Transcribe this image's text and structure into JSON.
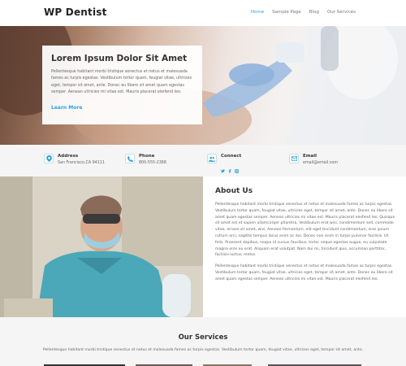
{
  "site": {
    "logo": "WP Dentist"
  },
  "nav": {
    "items": [
      {
        "label": "Home",
        "active": true
      },
      {
        "label": "Sample Page",
        "active": false
      },
      {
        "label": "Blog",
        "active": false
      },
      {
        "label": "Our Services",
        "active": false
      }
    ]
  },
  "hero": {
    "title": "Lorem Ipsum Dolor Sit Amet",
    "text": "Pellentesque habitant morbi tristique senectus et netus et malesuada fames ac turpis egestas. Vestibulum tortor quam, feugiat vitae, ultricies eget, tempor sit amet, ante. Donec eu libero sit amet quam egestas semper. Aenean ultricies mi vitae est. Mauris placerat eleifend leo.",
    "link": "Learn More"
  },
  "info": {
    "address": {
      "label": "Address",
      "value": "San Francisco,CA 94111",
      "icon": "location-pin-icon"
    },
    "phone": {
      "label": "Phone",
      "value": "800-555-2368",
      "icon": "phone-icon"
    },
    "connect": {
      "label": "Connect",
      "icon": "users-icon",
      "social": [
        "twitter-icon",
        "facebook-icon",
        "instagram-icon"
      ]
    },
    "email": {
      "label": "Email",
      "value": "email@email.com",
      "icon": "envelope-icon"
    }
  },
  "about": {
    "title": "About Us",
    "paragraph1": "Pellentesque habitant morbi tristique senectus et netus et malesuada fames ac turpis egestas. Vestibulum tortor quam, feugiat vitae, ultricies eget, tempor sit amet, ante. Donec eu libero sit amet quam egestas semper. Aenean ultricies mi vitae est. Mauris placerat eleifend leo. Quisque sit amet est et sapien ullamcorper pharetra. Vestibulum erat wisi, condimentum sed, commodo vitae, ornare sit amet, wisi. Aenean fermentum, elit eget tincidunt condimentum, eros ipsum rutrum orci, sagittis tempus lacus enim ac dui. Donec non enim in turpis pulvinar facilisis. Ut felis. Praesent dapibus, neque id cursus faucibus, tortor neque egestas augue, eu vulputate magna eros eu erat. Aliquam erat volutpat. Nam dui mi, tincidunt quis, accumsan porttitor, facilisis luctus, metus",
    "paragraph2": "Pellentesque habitant morbi tristique senectus et netus et malesuada fames ac turpis egestas. Vestibulum tortor quam, feugiat vitae, ultricies eget, tempor sit amet, ante. Donec eu libero sit amet quam egestas semper. Aenean ultricies mi vitae est. Mauris placerat eleifend leo."
  },
  "services": {
    "title": "Our Services",
    "text": "Pellentesque habitant morbi tristique senectus et netus et malesuada fames ac turpis egestas. Vestibulum tortor quam, feugiat vitae, ultricies eget, tempor sit amet, ante."
  },
  "colors": {
    "accent": "#27a3d9",
    "text": "#333333",
    "muted": "#666666",
    "band": "#f5f5f5"
  }
}
